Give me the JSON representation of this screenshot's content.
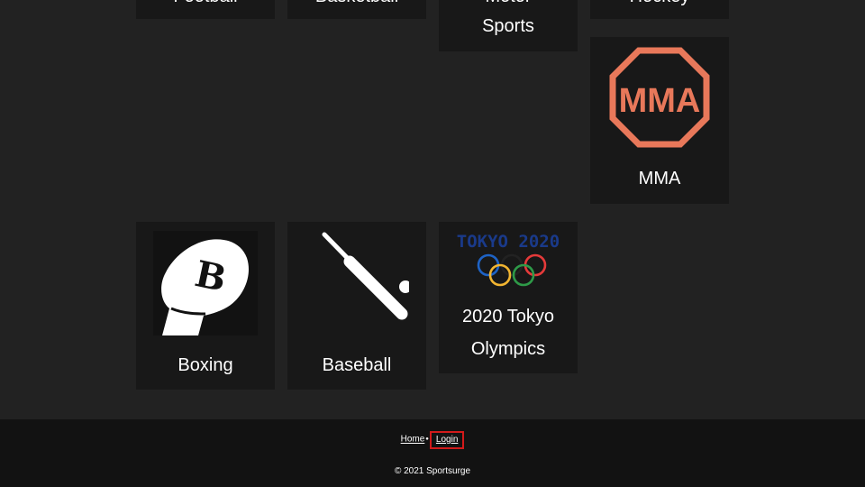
{
  "top_row": [
    {
      "label": "Football"
    },
    {
      "label": "Basketball"
    },
    {
      "label_line1": "Motor",
      "label_line2": "Sports"
    },
    {
      "label": "Hockey"
    }
  ],
  "cards": {
    "mma": {
      "label": "MMA",
      "icon_text": "MMA",
      "icon": "mma-octagon-icon"
    },
    "boxing": {
      "label": "Boxing",
      "icon": "boxing-glove-icon",
      "icon_letter": "B"
    },
    "baseball": {
      "label": "Baseball",
      "icon": "baseball-bat-icon"
    },
    "olympics": {
      "label_line1": "2020 Tokyo",
      "label_line2": "Olympics",
      "icon": "olympic-rings-icon",
      "icon_text": "TOKYO 2020"
    }
  },
  "footer": {
    "home": "Home",
    "separator": "●",
    "login": "Login",
    "copyright": "© 2021 Sportsurge"
  },
  "colors": {
    "background": "#222222",
    "card": "#181818",
    "footer": "#121212",
    "mma_accent": "#e8785a",
    "login_highlight": "#d21a1a",
    "tokyo_blue": "#1a3a8a"
  }
}
